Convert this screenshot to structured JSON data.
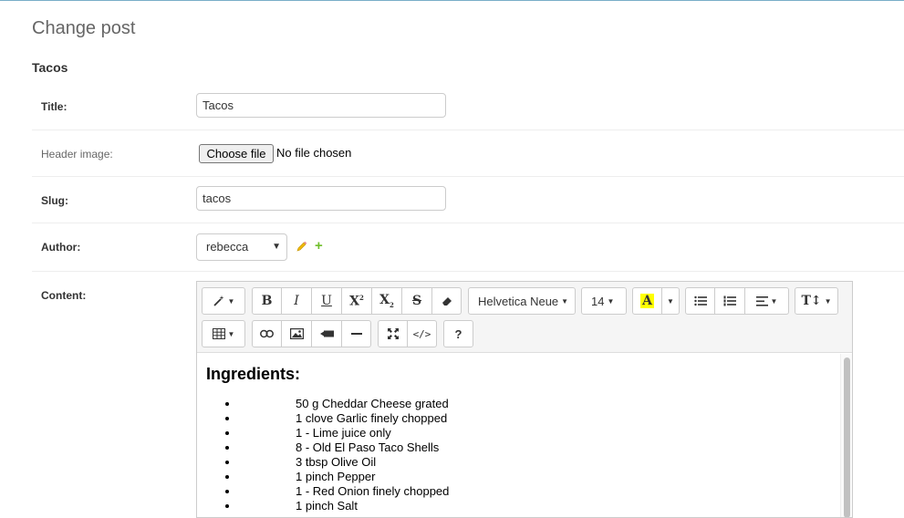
{
  "page": {
    "title": "Change post",
    "object_title": "Tacos"
  },
  "fields": {
    "title": {
      "label": "Title:",
      "value": "Tacos"
    },
    "header_image": {
      "label": "Header image:",
      "button": "Choose file",
      "status": "No file chosen"
    },
    "slug": {
      "label": "Slug:",
      "value": "tacos"
    },
    "author": {
      "label": "Author:",
      "selected": "rebecca"
    },
    "content": {
      "label": "Content:"
    }
  },
  "editor": {
    "toolbar": {
      "font_name": "Helvetica Neue",
      "font_size": "14",
      "bold": "B",
      "italic": "I",
      "underline": "U",
      "help": "?"
    },
    "heading": "Ingredients:",
    "ingredients": [
      "50 g Cheddar Cheese grated",
      "1 clove Garlic finely chopped",
      "1 - Lime juice only",
      "8 - Old El Paso Taco Shells",
      "3 tbsp Olive Oil",
      "1 pinch Pepper",
      "1 - Red Onion finely chopped",
      "1 pinch Salt"
    ]
  },
  "colors": {
    "accent_line": "#79aec8",
    "add_icon": "#70bf2b",
    "edit_icon": "#efb80b",
    "highlight": "#ffff00"
  }
}
